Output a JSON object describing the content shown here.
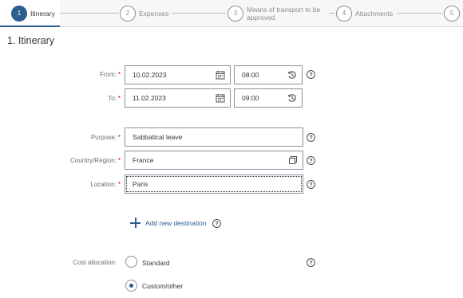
{
  "wizard": {
    "steps": [
      {
        "num": "1",
        "label": "Itinerary"
      },
      {
        "num": "2",
        "label": "Expenses"
      },
      {
        "num": "3",
        "label": "Means of transport to be approved"
      },
      {
        "num": "4",
        "label": "Attachments"
      },
      {
        "num": "5",
        "label": ""
      }
    ],
    "active_index": 0,
    "accent": "#2c5d8f"
  },
  "section_title": "1. Itinerary",
  "form": {
    "from_label": "From:",
    "from_date": "10.02.2023",
    "from_time": "08:00",
    "to_label": "To:",
    "to_date": "11.02.2023",
    "to_time": "09:00",
    "purpose_label": "Purpose:",
    "purpose_value": "Sabbatical leave",
    "country_label": "Country/Region:",
    "country_value": "France",
    "location_label": "Location:",
    "location_value": "Paris",
    "required_marker": "*",
    "help_glyph": "?",
    "add_destination": "Add new destination",
    "cost_allocation_label": "Cost allocation:",
    "cost_options": [
      {
        "label": "Standard",
        "selected": false
      },
      {
        "label": "Custom/other",
        "selected": true
      }
    ]
  },
  "icons": {
    "date": "calendar-icon",
    "time": "clock-icon",
    "value_help": "value-help-icon",
    "help": "help-icon",
    "add": "add-icon"
  }
}
